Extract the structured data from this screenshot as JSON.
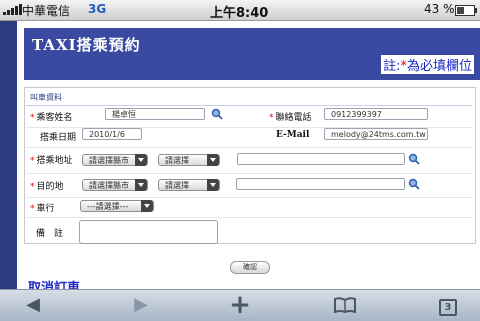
{
  "status": {
    "carrier": "中華電信",
    "network": "3G",
    "time": "上午8:40",
    "battery_percent": "43 %",
    "battery_level": 0.43
  },
  "header": {
    "title": "TAXI搭乘預約",
    "required_prefix": "註:",
    "required_star": "*",
    "required_suffix": "為必填欄位"
  },
  "section_title": "叫車資料",
  "form": {
    "passenger_label": "乘客姓名",
    "passenger_value": "楊卓恒",
    "phone_label": "聯絡電話",
    "phone_value": "0912399397",
    "date_label": "搭乘日期",
    "date_value": "2010/1/6",
    "email_label": "E-Mail",
    "email_value": "melody@24tms.com.tw",
    "pickup_label": "搭乘地址",
    "pickup_city": "請選擇縣市",
    "pickup_district": "請選擇",
    "dest_label": "目的地",
    "dest_city": "請選擇縣市",
    "dest_district": "請選擇",
    "company_label": "車行",
    "company_value": "---請選擇---",
    "note_label": "備　註"
  },
  "confirm_label": "確認",
  "footer_text": "取消訂車",
  "toolbar": {
    "back": "◀",
    "forward": "▶",
    "add": "+",
    "bookmarks": "📖",
    "pages": "3"
  }
}
